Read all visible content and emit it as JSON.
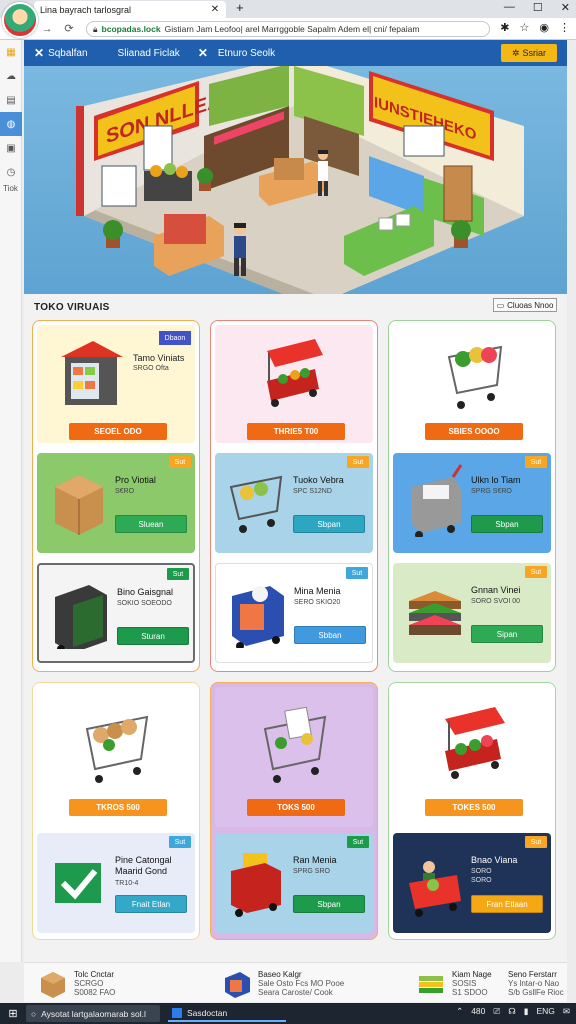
{
  "browser": {
    "tab_title": "Lina bayrach tarlosgral",
    "new_tab_icon": "+",
    "url_domain": "bcopadas.lock",
    "url_text": "Gistiarn Jam Leofoo| arel Marrggoble Sapalm Adem el| cni/ fepaiam",
    "window_controls": [
      "—",
      "☐",
      "✕"
    ]
  },
  "sidebar": {
    "items": [
      "home-icon",
      "cloud-icon",
      "user-icon",
      "doc-icon",
      "history-icon",
      "clock-icon"
    ],
    "label": "Tiok"
  },
  "appbar": {
    "items": [
      {
        "icon": "✕",
        "label": "Sqbalfan"
      },
      {
        "icon": "",
        "label": "Slianad Ficlak"
      },
      {
        "icon": "✕",
        "label": "Etnuro Seolk"
      }
    ],
    "action_label": "Ssriar"
  },
  "hero": {
    "sign_left": "SON NLLEA",
    "sign_right": "IUNSTIEHEKO"
  },
  "section": {
    "title": "TOKO VIRUAIS",
    "sort_label": "Cluoas Nnoo"
  },
  "cards": [
    {
      "top": {
        "name": "Tamo Viniats",
        "meta": "SRGO Ofta",
        "price": "SEOEL ODO",
        "tag": "Dbaon",
        "price_color": "#f06a14"
      },
      "items": [
        {
          "name": "Pro Viotial",
          "meta": "S€RO",
          "button": "Sluean",
          "tag": "Sut",
          "bg": "#8cc96a",
          "btn_color": "#2eaa54"
        },
        {
          "name": "Bino Gaisgnal",
          "meta": "SOKIO\nSOEODO",
          "button": "Sturan",
          "tag": "Sut",
          "bg": "#f4f4f4",
          "btn_color": "#1d9a4c"
        }
      ]
    },
    {
      "top": {
        "name": "",
        "meta": "",
        "price": "THRIE5 T00",
        "tag": "",
        "price_color": "#f06a14"
      },
      "items": [
        {
          "name": "Tuoko Vebra",
          "meta": "SPC\nS12ND",
          "button": "Sbpan",
          "tag": "Sut",
          "bg": "#a8d3e8",
          "btn_color": "#2da6c2"
        },
        {
          "name": "Mina Menia",
          "meta": "SERO\nSKIO20",
          "button": "Sbban",
          "tag": "Sut",
          "bg": "#ffffff",
          "btn_color": "#3f9ae0"
        }
      ]
    },
    {
      "top": {
        "name": "",
        "meta": "",
        "price": "SBIES OOOO",
        "tag": "",
        "price_color": "#f06a14"
      },
      "items": [
        {
          "name": "Ulkn lo Tiam",
          "meta": "SPRG\nS€RO",
          "button": "Sbpan",
          "tag": "Sut",
          "bg": "#5aa6e6",
          "btn_color": "#1d9a4c"
        },
        {
          "name": "Gnnan Vinei",
          "meta": "SORO\nSVOI 00",
          "button": "Sipan",
          "tag": "Sut",
          "bg": "#d8ebc6",
          "btn_color": "#2eaa54"
        }
      ]
    },
    {
      "top": {
        "name": "",
        "meta": "",
        "price": "TKROS 500",
        "tag": "",
        "price_color": "#f7941d"
      },
      "items": [
        {
          "name": "Pine Catongal\nMaarid Gond",
          "meta": "TR10-4",
          "button": "Fnait Etlan",
          "tag": "Sut",
          "bg": "#e7ecf8",
          "btn_color": "#33a8c8"
        }
      ]
    },
    {
      "top": {
        "name": "",
        "meta": "",
        "price": "TOKS 500",
        "tag": "",
        "price_color": "#f06a14"
      },
      "items": [
        {
          "name": "Ran Menia",
          "meta": "SPRG\nSRO",
          "button": "Sbpan",
          "tag": "Sut",
          "bg": "#a8d3e8",
          "btn_color": "#1d9a4c"
        }
      ]
    },
    {
      "top": {
        "name": "",
        "meta": "",
        "price": "TOKES 500",
        "tag": "",
        "price_color": "#f7941d"
      },
      "items": [
        {
          "name": "Bnao Viana",
          "meta": "SORO\nSORO",
          "button": "Fran Etlaan",
          "tag": "Sut",
          "bg": "#1f3358",
          "btn_color": "#f4a814"
        }
      ]
    }
  ],
  "footer": {
    "items": [
      {
        "title": "Tolc Cnctar",
        "meta": "SCRGO\nS0082 FAO"
      },
      {
        "title": "Baseo Kalgr",
        "meta": "Sale Osto Fcs MO Pooe\nSeara Caroste/ Cook"
      },
      {
        "title": "Kiam Nage",
        "meta": "SOSIS\nS1 SDOO"
      },
      {
        "title": "Seno Ferstarr",
        "meta": "Ys lntar-o Nao\nS/b GsllFe Rioc"
      }
    ]
  },
  "taskbar": {
    "search_text": "Aysotat lartgalaomarab sol.l",
    "app_label": "Sasdoctan",
    "tray": [
      "⌃",
      "480",
      "⎚",
      "☊",
      "▮",
      "ENG",
      "✉"
    ]
  }
}
